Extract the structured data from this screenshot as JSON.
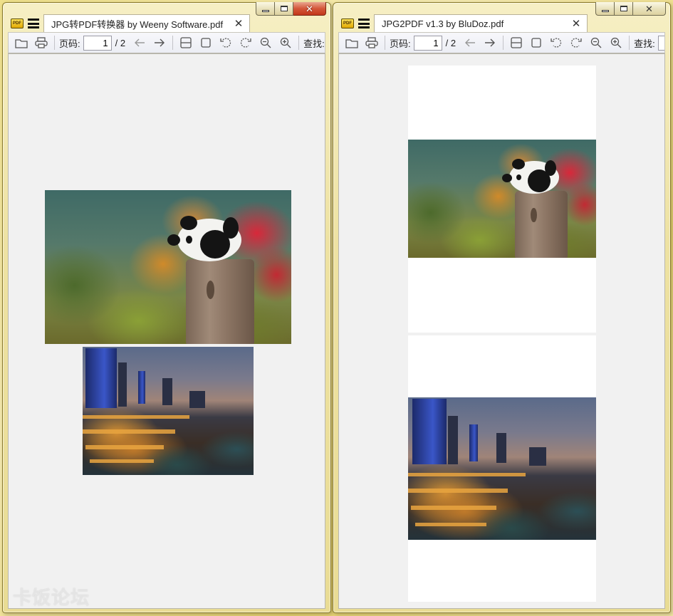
{
  "windows": [
    {
      "tab_title": "JPG转PDF转换器 by Weeny Software.pdf",
      "toolbar": {
        "page_label": "页码:",
        "page_value": "1",
        "page_total": "/ 2",
        "find_label": "查找:"
      }
    },
    {
      "tab_title": "JPG2PDF v1.3 by BluDoz.pdf",
      "toolbar": {
        "page_label": "页码:",
        "page_value": "1",
        "page_total": "/ 2",
        "find_label": "查找:"
      }
    }
  ],
  "app_icon_text": "PDF",
  "watermark": "卡饭论坛",
  "colors": {
    "frame": "#eee2a2",
    "viewer_bg": "#f1f1f1",
    "close_button": "#d4573a"
  },
  "images": {
    "first": "panda-photo",
    "second": "city-night-photo"
  }
}
